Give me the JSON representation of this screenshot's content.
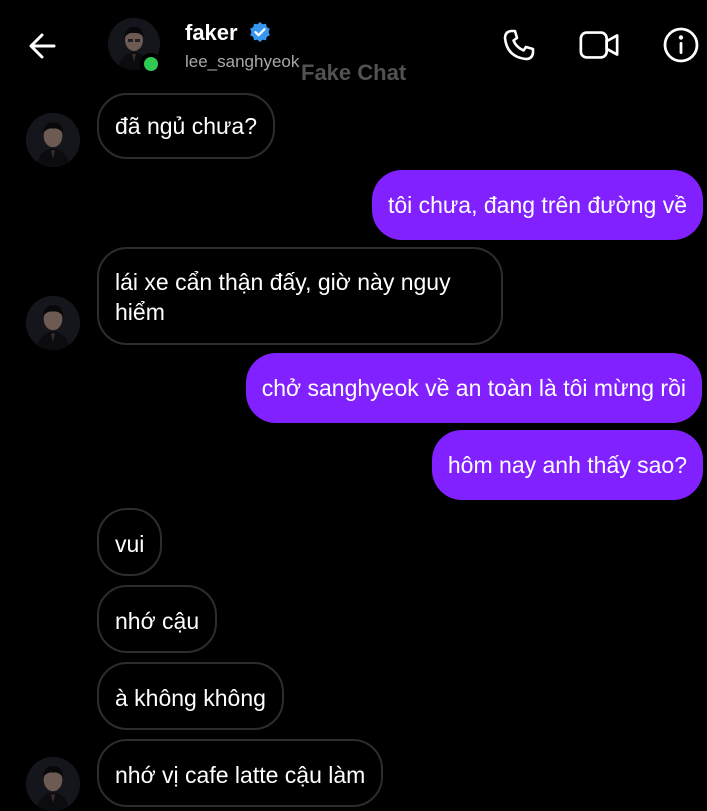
{
  "header": {
    "contact_name": "faker",
    "contact_handle": "lee_sanghyeok",
    "watermark": "Fake Chat",
    "icons": {
      "back": "arrow-left-icon",
      "verified": "verified-badge-icon",
      "call": "phone-icon",
      "video": "video-camera-icon",
      "info": "info-icon"
    },
    "online": true
  },
  "colors": {
    "background": "#000000",
    "outgoing_bubble": "#8221ff",
    "incoming_border": "#2d2d2d",
    "verified_blue": "#3797f0",
    "online_green": "#31c953"
  },
  "messages": [
    {
      "side": "in",
      "text": "đã ngủ chưa?",
      "avatar": true
    },
    {
      "side": "out",
      "text": "tôi chưa, đang trên đường về"
    },
    {
      "side": "in",
      "text": "lái xe cẩn thận đấy, giờ này nguy hiểm",
      "avatar": true
    },
    {
      "side": "out",
      "text": "chở sanghyeok về an toàn là tôi mừng rồi"
    },
    {
      "side": "out",
      "text": "hôm nay anh thấy sao?"
    },
    {
      "side": "in",
      "text": "vui"
    },
    {
      "side": "in",
      "text": "nhớ cậu"
    },
    {
      "side": "in",
      "text": "à không không"
    },
    {
      "side": "in",
      "text": "nhớ vị cafe latte cậu làm",
      "avatar": true
    }
  ]
}
